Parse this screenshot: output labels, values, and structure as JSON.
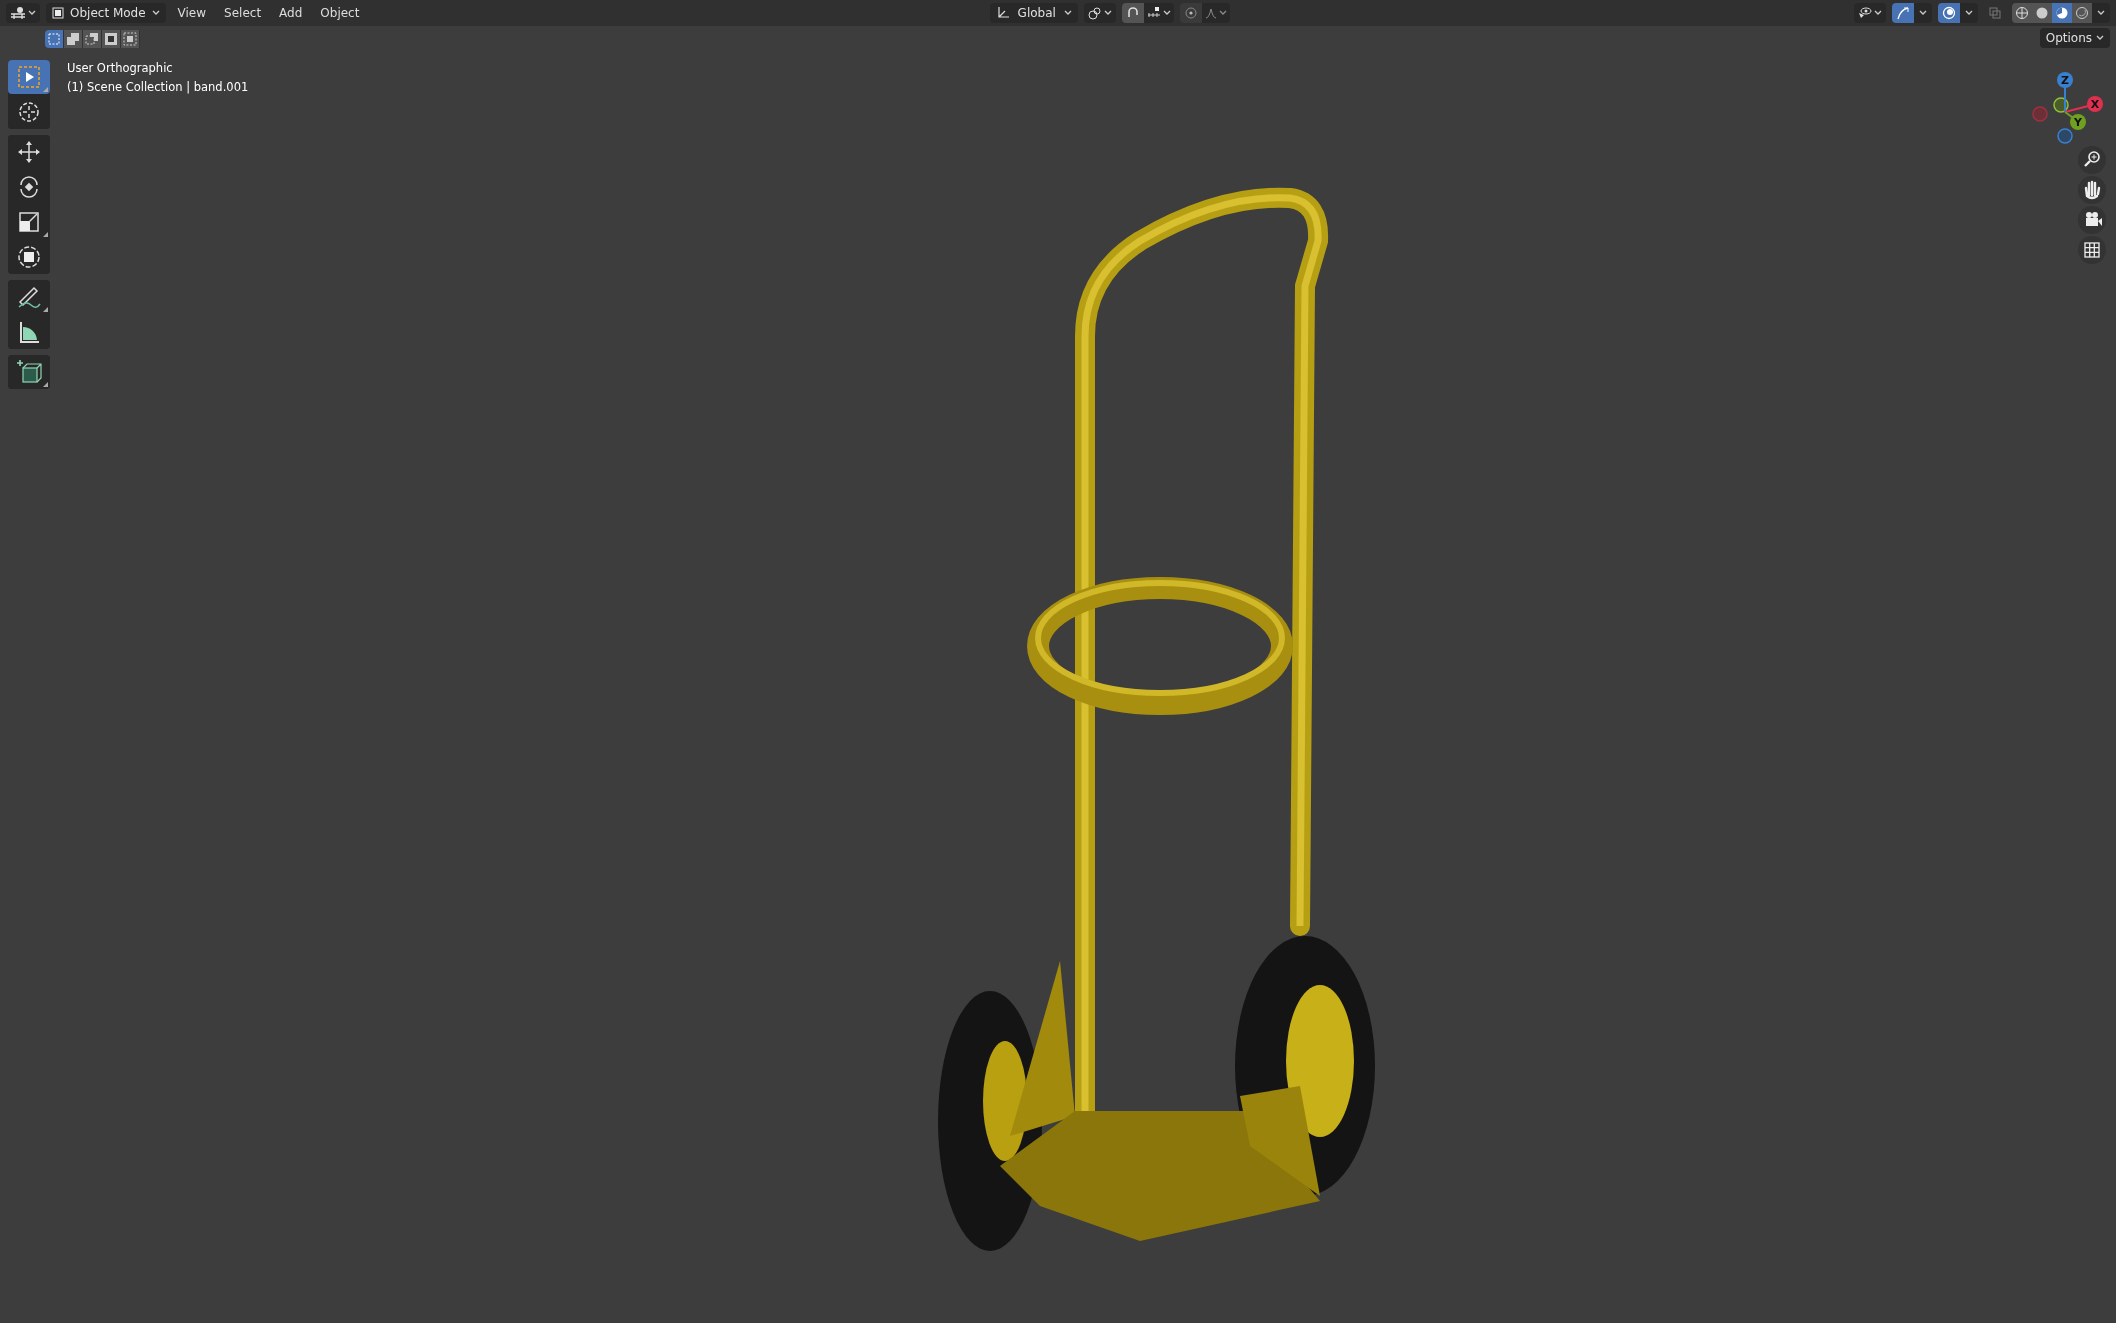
{
  "header": {
    "mode": "Object Mode",
    "menus": [
      "View",
      "Select",
      "Add",
      "Object"
    ],
    "select_modes": [
      {
        "selected": true
      },
      {
        "selected": false
      },
      {
        "selected": false
      },
      {
        "selected": false
      },
      {
        "selected": false
      }
    ],
    "orientation": "Global",
    "snap": {
      "on": false
    },
    "proportional": {
      "on": false
    },
    "gizmos": {
      "on": true
    },
    "overlays": {
      "on": true
    },
    "xray": {
      "on": false
    },
    "shading": [
      {
        "selected": false
      },
      {
        "selected": false
      },
      {
        "selected": true
      },
      {
        "selected": false
      }
    ]
  },
  "options": "Options",
  "viewport_info": [
    "User Orthographic",
    "(1) Scene Collection | band.001"
  ],
  "toolbar": {
    "groups": [
      {
        "tools": [
          {
            "selected": true,
            "has_variants": true
          },
          {
            "selected": false,
            "has_variants": false
          }
        ]
      },
      {
        "tools": [
          {
            "selected": false,
            "has_variants": false
          },
          {
            "selected": false,
            "has_variants": false
          },
          {
            "selected": false,
            "has_variants": true
          },
          {
            "selected": false,
            "has_variants": false
          }
        ]
      },
      {
        "tools": [
          {
            "selected": false,
            "has_variants": true
          },
          {
            "selected": false,
            "has_variants": false
          }
        ]
      },
      {
        "tools": [
          {
            "selected": false,
            "has_variants": true
          }
        ]
      }
    ]
  },
  "axis_gizmo": {
    "labels": [
      "Z",
      "X",
      "Y"
    ]
  }
}
